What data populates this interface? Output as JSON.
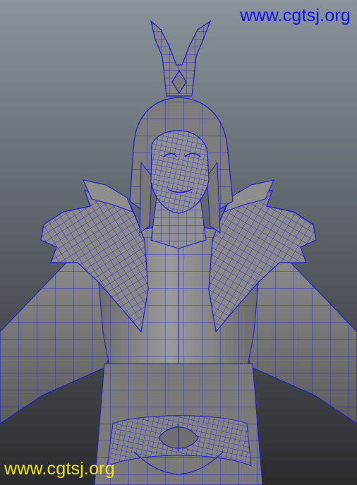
{
  "watermark_top": {
    "text": "www.cgtsj.org",
    "color": "#0a14e6"
  },
  "watermark_bottom": {
    "text": "www.cgtsj.org",
    "color": "#f2e600"
  },
  "colors": {
    "background_top": "#8a939b",
    "background_bottom": "#2a2c30",
    "mesh_fill": "#8c8c8c",
    "mesh_shadow": "#5a5a5a",
    "wireframe": "#1c1ad2"
  }
}
